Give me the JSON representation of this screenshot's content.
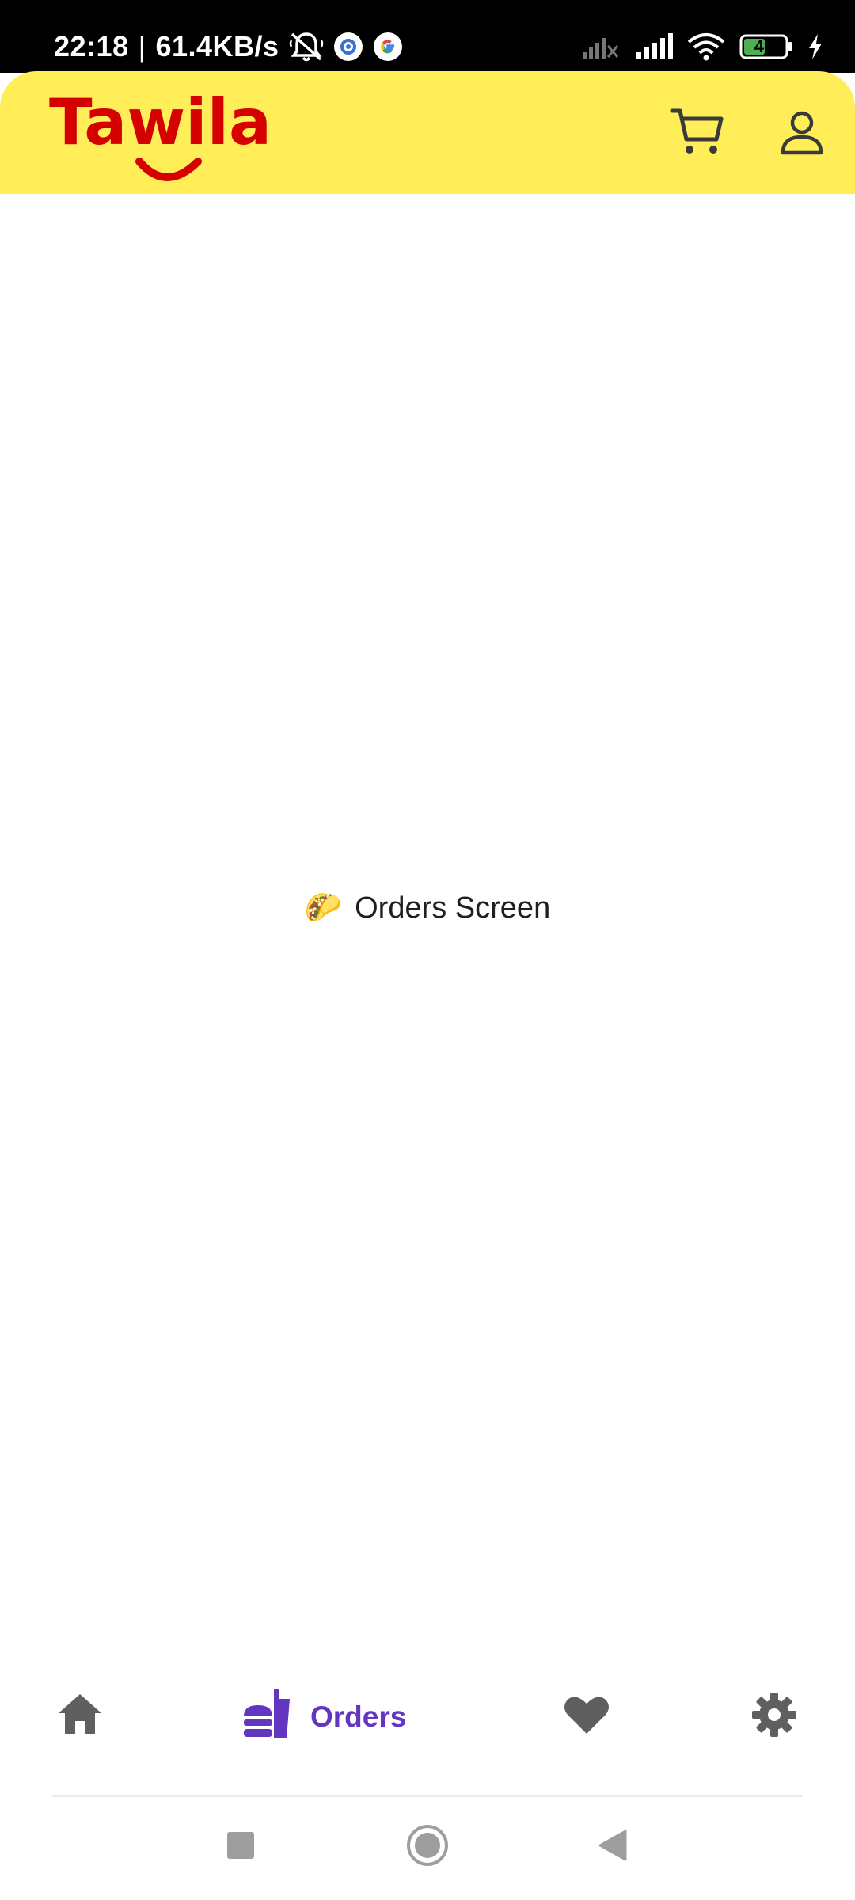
{
  "status_bar": {
    "time": "22:18",
    "separator": "|",
    "network_speed": "61.4KB/s",
    "battery_level": "49",
    "icons": [
      "bell-off-icon",
      "settings-badge-icon",
      "google-icon",
      "signal-off-icon",
      "signal-icon",
      "wifi-icon",
      "battery-icon",
      "charging-icon"
    ]
  },
  "header": {
    "logo_text": "Tawila",
    "logo_color": "#D50000",
    "background": "#FFEE58",
    "icons": [
      "cart-icon",
      "profile-icon"
    ]
  },
  "main": {
    "emoji": "🌮",
    "message": "Orders Screen"
  },
  "bottom_nav": {
    "active_color": "#6236C0",
    "inactive_color": "#5f5f5f",
    "items": [
      {
        "icon": "home-icon",
        "label": ""
      },
      {
        "icon": "fastfood-icon",
        "label": "Orders"
      },
      {
        "icon": "heart-icon",
        "label": ""
      },
      {
        "icon": "gear-icon",
        "label": ""
      }
    ]
  },
  "system_nav": {
    "icons": [
      "recents-icon",
      "home-circle-icon",
      "back-icon"
    ]
  }
}
